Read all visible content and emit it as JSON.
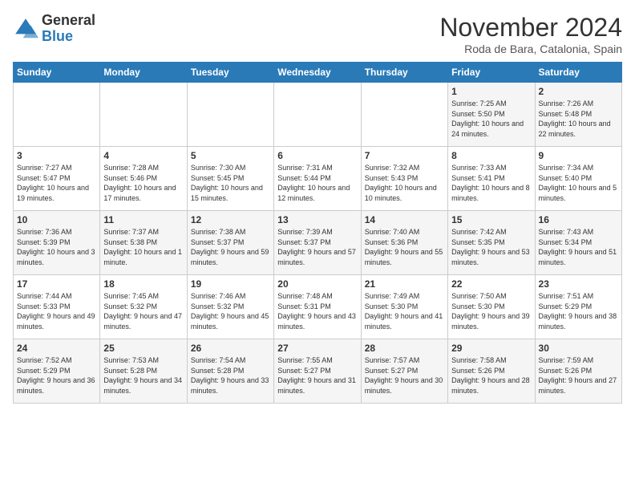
{
  "header": {
    "logo_general": "General",
    "logo_blue": "Blue",
    "month_title": "November 2024",
    "subtitle": "Roda de Bara, Catalonia, Spain"
  },
  "weekdays": [
    "Sunday",
    "Monday",
    "Tuesday",
    "Wednesday",
    "Thursday",
    "Friday",
    "Saturday"
  ],
  "weeks": [
    [
      {
        "day": "",
        "info": ""
      },
      {
        "day": "",
        "info": ""
      },
      {
        "day": "",
        "info": ""
      },
      {
        "day": "",
        "info": ""
      },
      {
        "day": "",
        "info": ""
      },
      {
        "day": "1",
        "info": "Sunrise: 7:25 AM\nSunset: 5:50 PM\nDaylight: 10 hours and 24 minutes."
      },
      {
        "day": "2",
        "info": "Sunrise: 7:26 AM\nSunset: 5:48 PM\nDaylight: 10 hours and 22 minutes."
      }
    ],
    [
      {
        "day": "3",
        "info": "Sunrise: 7:27 AM\nSunset: 5:47 PM\nDaylight: 10 hours and 19 minutes."
      },
      {
        "day": "4",
        "info": "Sunrise: 7:28 AM\nSunset: 5:46 PM\nDaylight: 10 hours and 17 minutes."
      },
      {
        "day": "5",
        "info": "Sunrise: 7:30 AM\nSunset: 5:45 PM\nDaylight: 10 hours and 15 minutes."
      },
      {
        "day": "6",
        "info": "Sunrise: 7:31 AM\nSunset: 5:44 PM\nDaylight: 10 hours and 12 minutes."
      },
      {
        "day": "7",
        "info": "Sunrise: 7:32 AM\nSunset: 5:43 PM\nDaylight: 10 hours and 10 minutes."
      },
      {
        "day": "8",
        "info": "Sunrise: 7:33 AM\nSunset: 5:41 PM\nDaylight: 10 hours and 8 minutes."
      },
      {
        "day": "9",
        "info": "Sunrise: 7:34 AM\nSunset: 5:40 PM\nDaylight: 10 hours and 5 minutes."
      }
    ],
    [
      {
        "day": "10",
        "info": "Sunrise: 7:36 AM\nSunset: 5:39 PM\nDaylight: 10 hours and 3 minutes."
      },
      {
        "day": "11",
        "info": "Sunrise: 7:37 AM\nSunset: 5:38 PM\nDaylight: 10 hours and 1 minute."
      },
      {
        "day": "12",
        "info": "Sunrise: 7:38 AM\nSunset: 5:37 PM\nDaylight: 9 hours and 59 minutes."
      },
      {
        "day": "13",
        "info": "Sunrise: 7:39 AM\nSunset: 5:37 PM\nDaylight: 9 hours and 57 minutes."
      },
      {
        "day": "14",
        "info": "Sunrise: 7:40 AM\nSunset: 5:36 PM\nDaylight: 9 hours and 55 minutes."
      },
      {
        "day": "15",
        "info": "Sunrise: 7:42 AM\nSunset: 5:35 PM\nDaylight: 9 hours and 53 minutes."
      },
      {
        "day": "16",
        "info": "Sunrise: 7:43 AM\nSunset: 5:34 PM\nDaylight: 9 hours and 51 minutes."
      }
    ],
    [
      {
        "day": "17",
        "info": "Sunrise: 7:44 AM\nSunset: 5:33 PM\nDaylight: 9 hours and 49 minutes."
      },
      {
        "day": "18",
        "info": "Sunrise: 7:45 AM\nSunset: 5:32 PM\nDaylight: 9 hours and 47 minutes."
      },
      {
        "day": "19",
        "info": "Sunrise: 7:46 AM\nSunset: 5:32 PM\nDaylight: 9 hours and 45 minutes."
      },
      {
        "day": "20",
        "info": "Sunrise: 7:48 AM\nSunset: 5:31 PM\nDaylight: 9 hours and 43 minutes."
      },
      {
        "day": "21",
        "info": "Sunrise: 7:49 AM\nSunset: 5:30 PM\nDaylight: 9 hours and 41 minutes."
      },
      {
        "day": "22",
        "info": "Sunrise: 7:50 AM\nSunset: 5:30 PM\nDaylight: 9 hours and 39 minutes."
      },
      {
        "day": "23",
        "info": "Sunrise: 7:51 AM\nSunset: 5:29 PM\nDaylight: 9 hours and 38 minutes."
      }
    ],
    [
      {
        "day": "24",
        "info": "Sunrise: 7:52 AM\nSunset: 5:29 PM\nDaylight: 9 hours and 36 minutes."
      },
      {
        "day": "25",
        "info": "Sunrise: 7:53 AM\nSunset: 5:28 PM\nDaylight: 9 hours and 34 minutes."
      },
      {
        "day": "26",
        "info": "Sunrise: 7:54 AM\nSunset: 5:28 PM\nDaylight: 9 hours and 33 minutes."
      },
      {
        "day": "27",
        "info": "Sunrise: 7:55 AM\nSunset: 5:27 PM\nDaylight: 9 hours and 31 minutes."
      },
      {
        "day": "28",
        "info": "Sunrise: 7:57 AM\nSunset: 5:27 PM\nDaylight: 9 hours and 30 minutes."
      },
      {
        "day": "29",
        "info": "Sunrise: 7:58 AM\nSunset: 5:26 PM\nDaylight: 9 hours and 28 minutes."
      },
      {
        "day": "30",
        "info": "Sunrise: 7:59 AM\nSunset: 5:26 PM\nDaylight: 9 hours and 27 minutes."
      }
    ]
  ]
}
